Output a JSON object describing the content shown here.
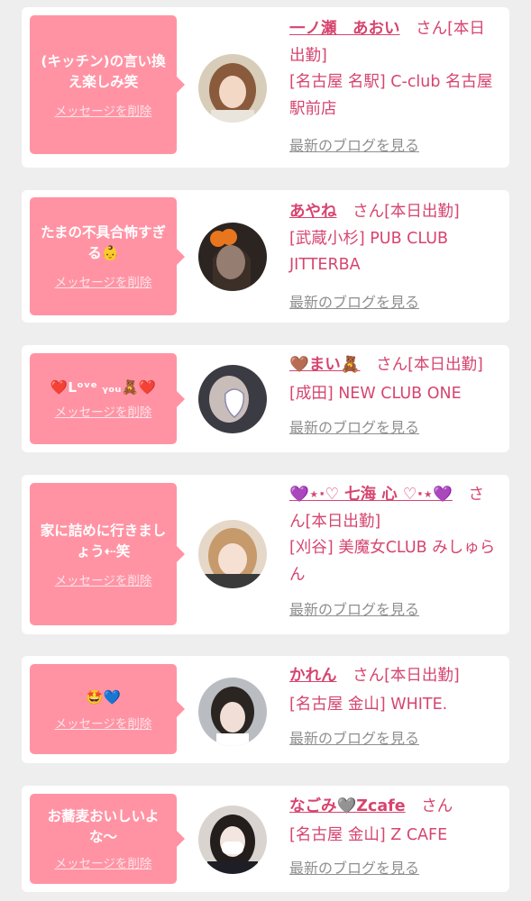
{
  "common": {
    "delete_label": "メッセージを削除",
    "blog_label": "最新のブログを見る",
    "san": "さん"
  },
  "colors": {
    "accent_pink": "#d6456f",
    "bubble_pink": "#ff93a4",
    "card_bg": "#ffffff",
    "page_bg": "#eeeeee",
    "link_gray": "#8f8f8f"
  },
  "cards": [
    {
      "message": "(キッチン)の言い換え楽しみ笑",
      "name": "一ノ瀬　あおい",
      "status": "[本日出勤]",
      "shop": "[名古屋 名駅] C-club 名古屋駅前店"
    },
    {
      "message": "たまの不具合怖すぎる👶",
      "name": "あやね",
      "status": "[本日出勤]",
      "shop": "[武蔵小杉] PUB CLUB JITTERBA"
    },
    {
      "message": "❤️Lᵒᵛᵉ ᵧₒᵤ🧸❤️",
      "name": "🤎まい🧸",
      "status": "[本日出勤]",
      "shop": "[成田] NEW CLUB ONE"
    },
    {
      "message": "家に詰めに行きましょう⇠笑",
      "name": "💜⋆⋅♡ 七海 心 ♡⋅⋆💜",
      "status": "[本日出勤]",
      "shop": "[刈谷] 美魔女CLUB みしゅらん"
    },
    {
      "message": "🤩💙",
      "name": "かれん",
      "status": "[本日出勤]",
      "shop": "[名古屋 金山] WHITE."
    },
    {
      "message": "お蕎麦おいしいよな〜",
      "name": "なごみ🩶Zcafe",
      "status": "",
      "shop": "[名古屋 金山] Z CAFE"
    }
  ]
}
